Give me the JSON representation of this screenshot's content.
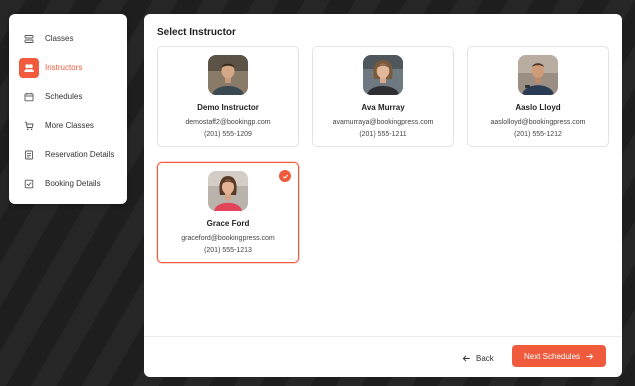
{
  "sidebar": {
    "items": [
      {
        "label": "Classes",
        "icon": "list-icon",
        "active": false
      },
      {
        "label": "Instructors",
        "icon": "users-icon",
        "active": true
      },
      {
        "label": "Schedules",
        "icon": "calendar-icon",
        "active": false
      },
      {
        "label": "More Classes",
        "icon": "cart-icon",
        "active": false
      },
      {
        "label": "Reservation Details",
        "icon": "document-icon",
        "active": false
      },
      {
        "label": "Booking Details",
        "icon": "checklist-icon",
        "active": false
      }
    ]
  },
  "main": {
    "title": "Select Instructor",
    "instructors": [
      {
        "name": "Demo Instructor",
        "email": "demostaff2@bookingp.com",
        "phone": "(201) 555-1209",
        "selected": false
      },
      {
        "name": "Ava Murray",
        "email": "avamurraya@bookingpress.com",
        "phone": "(201) 555-1211",
        "selected": false
      },
      {
        "name": "Aaslo Lloyd",
        "email": "aaslolloyd@bookingpress.com",
        "phone": "(201) 555-1212",
        "selected": false
      },
      {
        "name": "Grace Ford",
        "email": "graceford@bookingpress.com",
        "phone": "(201) 555-1213",
        "selected": true
      }
    ]
  },
  "footer": {
    "back_label": "Back",
    "next_label": "Next Schedules"
  },
  "colors": {
    "accent": "#ef5b3c"
  }
}
